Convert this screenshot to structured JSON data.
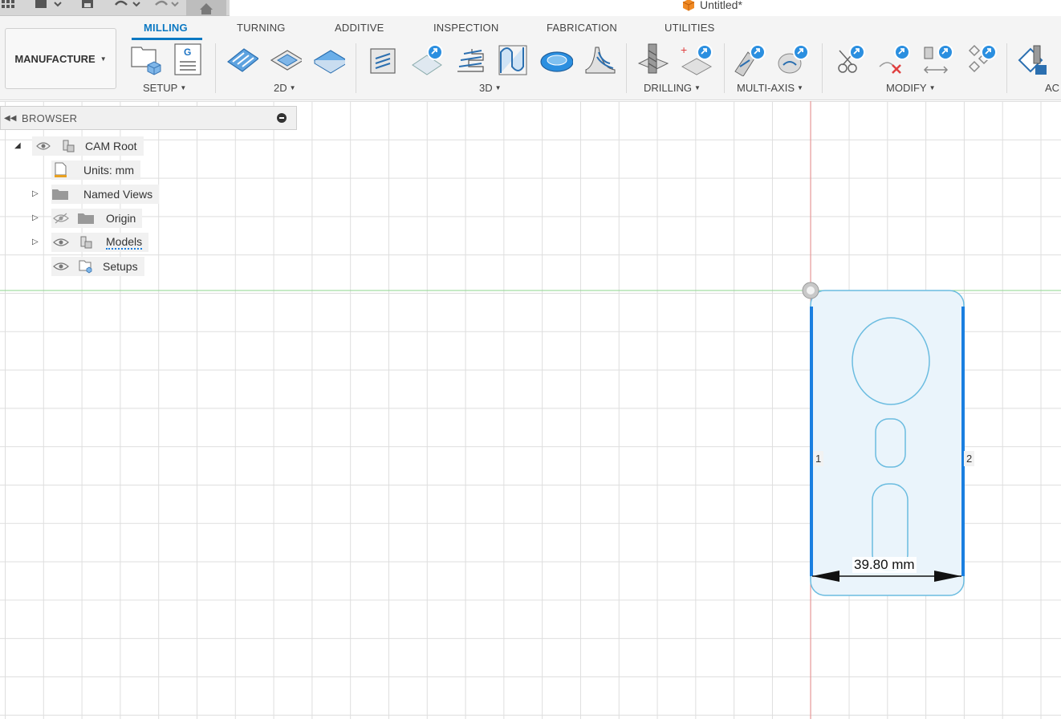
{
  "document": {
    "title": "Untitled*"
  },
  "ribbon": {
    "workspace": "MANUFACTURE",
    "tabs": [
      {
        "label": "MILLING",
        "active": true
      },
      {
        "label": "TURNING"
      },
      {
        "label": "ADDITIVE"
      },
      {
        "label": "INSPECTION"
      },
      {
        "label": "FABRICATION"
      },
      {
        "label": "UTILITIES"
      }
    ],
    "groups": {
      "setup": "SETUP",
      "g2d": "2D",
      "g3d": "3D",
      "drilling": "DRILLING",
      "multiaxis": "MULTI-AXIS",
      "modify": "MODIFY",
      "actions": "AC"
    }
  },
  "browser": {
    "title": "BROWSER",
    "items": [
      {
        "label": "CAM Root"
      },
      {
        "label": "Units: mm"
      },
      {
        "label": "Named Views"
      },
      {
        "label": "Origin"
      },
      {
        "label": "Models"
      },
      {
        "label": "Setups"
      }
    ]
  },
  "canvas": {
    "dimension_label": "39.80 mm",
    "edge_1": "1",
    "edge_2": "2"
  },
  "colors": {
    "accent": "#0b78c2",
    "selection": "#1a7fe0",
    "profile": "#6bbce0",
    "x_axis": "#e88a8a",
    "y_axis": "#8ed48e"
  },
  "icons": [
    "grid-menu-icon",
    "file-icon",
    "save-icon",
    "undo-icon",
    "redo-icon",
    "home-icon",
    "fusion-cube-icon"
  ]
}
